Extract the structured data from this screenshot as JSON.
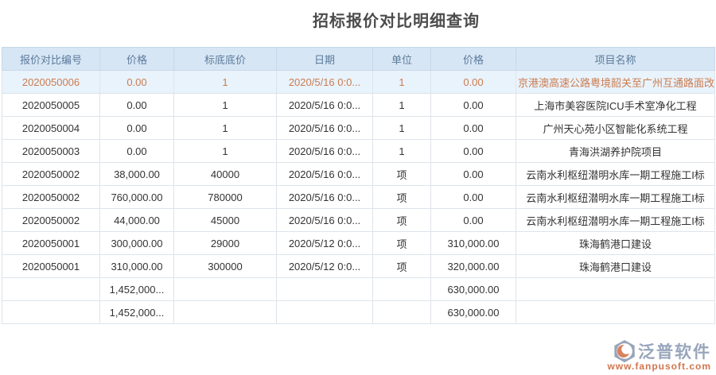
{
  "title": "招标报价对比明细查询",
  "table": {
    "columns": [
      "报价对比编号",
      "价格",
      "标底底价",
      "日期",
      "单位",
      "价格",
      "项目名称"
    ],
    "rows": [
      {
        "id": "2020050006",
        "price": "0.00",
        "base": "1",
        "date": "2020/5/16 0:0...",
        "unit": "1",
        "price2": "0.00",
        "project": "京港澳高速公路粤境韶关至广州互通路面改",
        "highlight": true
      },
      {
        "id": "2020050005",
        "price": "0.00",
        "base": "1",
        "date": "2020/5/16 0:0...",
        "unit": "1",
        "price2": "0.00",
        "project": "上海市美容医院ICU手术室净化工程",
        "highlight": false
      },
      {
        "id": "2020050004",
        "price": "0.00",
        "base": "1",
        "date": "2020/5/16 0:0...",
        "unit": "1",
        "price2": "0.00",
        "project": "广州天心苑小区智能化系统工程",
        "highlight": false
      },
      {
        "id": "2020050003",
        "price": "0.00",
        "base": "1",
        "date": "2020/5/16 0:0...",
        "unit": "1",
        "price2": "0.00",
        "project": "青海洪湖养护院项目",
        "highlight": false
      },
      {
        "id": "2020050002",
        "price": "38,000.00",
        "base": "40000",
        "date": "2020/5/16 0:0...",
        "unit": "项",
        "price2": "0.00",
        "project": "云南水利枢纽潜明水库一期工程施工I标",
        "highlight": false
      },
      {
        "id": "2020050002",
        "price": "760,000.00",
        "base": "780000",
        "date": "2020/5/16 0:0...",
        "unit": "项",
        "price2": "0.00",
        "project": "云南水利枢纽潜明水库一期工程施工I标",
        "highlight": false
      },
      {
        "id": "2020050002",
        "price": "44,000.00",
        "base": "45000",
        "date": "2020/5/16 0:0...",
        "unit": "项",
        "price2": "0.00",
        "project": "云南水利枢纽潜明水库一期工程施工I标",
        "highlight": false
      },
      {
        "id": "2020050001",
        "price": "300,000.00",
        "base": "29000",
        "date": "2020/5/12 0:0...",
        "unit": "项",
        "price2": "310,000.00",
        "project": "珠海鹤港口建设",
        "highlight": false
      },
      {
        "id": "2020050001",
        "price": "310,000.00",
        "base": "300000",
        "date": "2020/5/12 0:0...",
        "unit": "项",
        "price2": "320,000.00",
        "project": "珠海鹤港口建设",
        "highlight": false
      }
    ],
    "total_rows": [
      {
        "price": "1,452,000...",
        "price2": "630,000.00"
      },
      {
        "price": "1,452,000...",
        "price2": "630,000.00"
      }
    ]
  },
  "footer": {
    "brand": "泛普软件",
    "url": "www.fanpusoft.com"
  },
  "colors": {
    "header_bg": "#d7e6f4",
    "header_text": "#5b7b9c",
    "link": "#428bca",
    "highlight_bg": "#e9f3fc",
    "highlight_text": "#cb7c50",
    "brand_gray": "#98a6bb",
    "brand_orange": "#d2754e"
  }
}
